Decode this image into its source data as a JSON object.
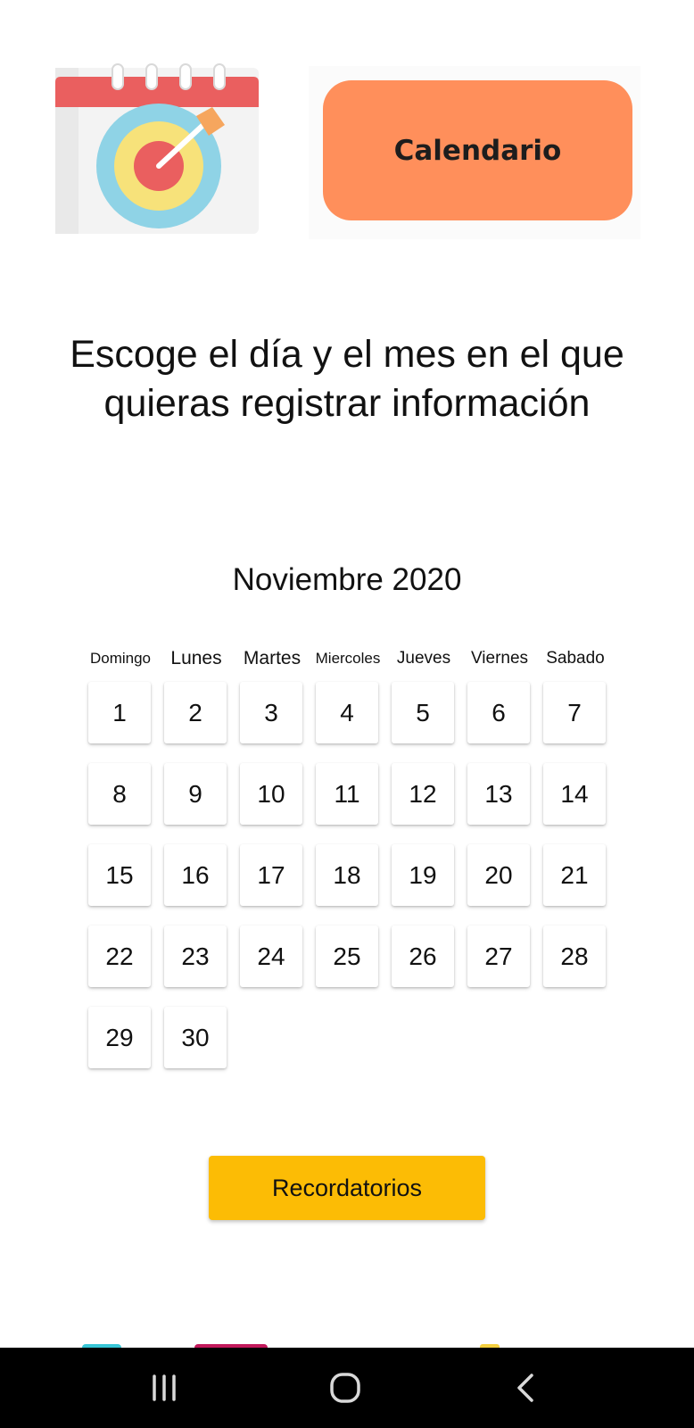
{
  "header": {
    "banner_label": "Calendario"
  },
  "instruction": {
    "line1": "Escoge el día y el mes en el que",
    "line2": "quieras registrar información"
  },
  "calendar": {
    "month_title": "Noviembre 2020",
    "weekdays": [
      "Domingo",
      "Lunes",
      "Martes",
      "Miercoles",
      "Jueves",
      "Viernes",
      "Sabado"
    ],
    "days": [
      "1",
      "2",
      "3",
      "4",
      "5",
      "6",
      "7",
      "8",
      "9",
      "10",
      "11",
      "12",
      "13",
      "14",
      "15",
      "16",
      "17",
      "18",
      "19",
      "20",
      "21",
      "22",
      "23",
      "24",
      "25",
      "26",
      "27",
      "28",
      "29",
      "30"
    ]
  },
  "actions": {
    "reminders_label": "Recordatorios"
  },
  "colors": {
    "banner": "#ff8f5b",
    "reminders_button": "#fcbc05",
    "logo_red": "#ea5f5f",
    "logo_blue": "#8fd3e6",
    "logo_yellow": "#f7e27a",
    "logo_orange": "#f6a65e"
  },
  "icons": {
    "logo": "calendar-target-icon",
    "nav_recents": "recents-icon",
    "nav_home": "home-icon",
    "nav_back": "back-icon"
  }
}
